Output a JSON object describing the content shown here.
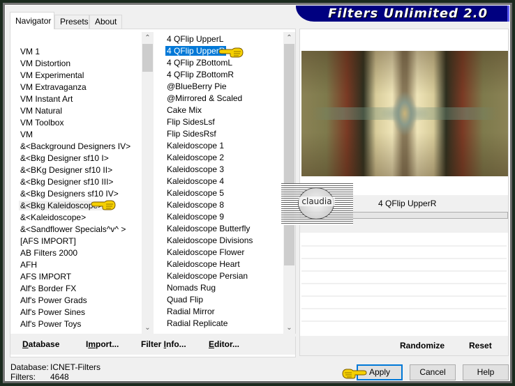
{
  "app": {
    "title": "Filters Unlimited 2.0"
  },
  "tabs": [
    {
      "label": "Navigator",
      "active": true
    },
    {
      "label": "Presets",
      "active": false
    },
    {
      "label": "About",
      "active": false
    }
  ],
  "categories": {
    "items": [
      "VM 1",
      "VM Distortion",
      "VM Experimental",
      "VM Extravaganza",
      "VM Instant Art",
      "VM Natural",
      "VM Toolbox",
      "VM",
      "&<Background Designers IV>",
      "&<Bkg Designer sf10 I>",
      "&<BKg Designer sf10 II>",
      "&<Bkg Designer sf10 III>",
      "&<Bkg Designers sf10 IV>",
      "&<Bkg Kaleidoscope>",
      "&<Kaleidoscope>",
      "&<Sandflower Specials^v^ >",
      "[AFS IMPORT]",
      "AB Filters 2000",
      "AFH",
      "AFS IMPORT",
      "Alf's Border FX",
      "Alf's Power Grads",
      "Alf's Power Sines",
      "Alf's Power Toys"
    ],
    "selected": "&<Bkg Kaleidoscope>"
  },
  "filters": {
    "items": [
      "4 QFlip UpperL",
      "4 QFlip UpperR",
      "4 QFlip ZBottomL",
      "4 QFlip ZBottomR",
      "@BlueBerry Pie",
      "@Mirrored & Scaled",
      "Cake Mix",
      "Flip SidesLsf",
      "Flip SidesRsf",
      "Kaleidoscope 1",
      "Kaleidoscope 2",
      "Kaleidoscope 3",
      "Kaleidoscope 4",
      "Kaleidoscope 5",
      "Kaleidoscope 8",
      "Kaleidoscope 9",
      "Kaleidoscope Butterfly",
      "Kaleidoscope Divisions",
      "Kaleidoscope Flower",
      "Kaleidoscope Heart",
      "Kaleidoscope Persian",
      "Nomads Rug",
      "Quad Flip",
      "Radial Mirror",
      "Radial Replicate"
    ],
    "selected": "4 QFlip UpperR"
  },
  "left_buttons": {
    "database": {
      "pre": "",
      "ul": "D",
      "post": "atabase"
    },
    "import": {
      "pre": "I",
      "ul": "m",
      "post": "port..."
    },
    "filter_info": {
      "pre": "Filter ",
      "ul": "I",
      "post": "nfo..."
    },
    "editor": {
      "pre": "",
      "ul": "E",
      "post": "ditor..."
    }
  },
  "preview": {
    "filter_name": "4 QFlip UpperR"
  },
  "right_buttons": {
    "randomize": "Randomize",
    "reset": "Reset"
  },
  "status": {
    "database_label": "Database:",
    "database_value": "ICNET-Filters",
    "filters_label": "Filters:",
    "filters_value": "4648"
  },
  "dialog_buttons": {
    "apply": "Apply",
    "cancel": "Cancel",
    "help": "Help"
  },
  "watermark": {
    "text": "claudia"
  },
  "colors": {
    "selection": "#0078d7",
    "banner": "#000080",
    "default_button_border": "#0078d7"
  }
}
